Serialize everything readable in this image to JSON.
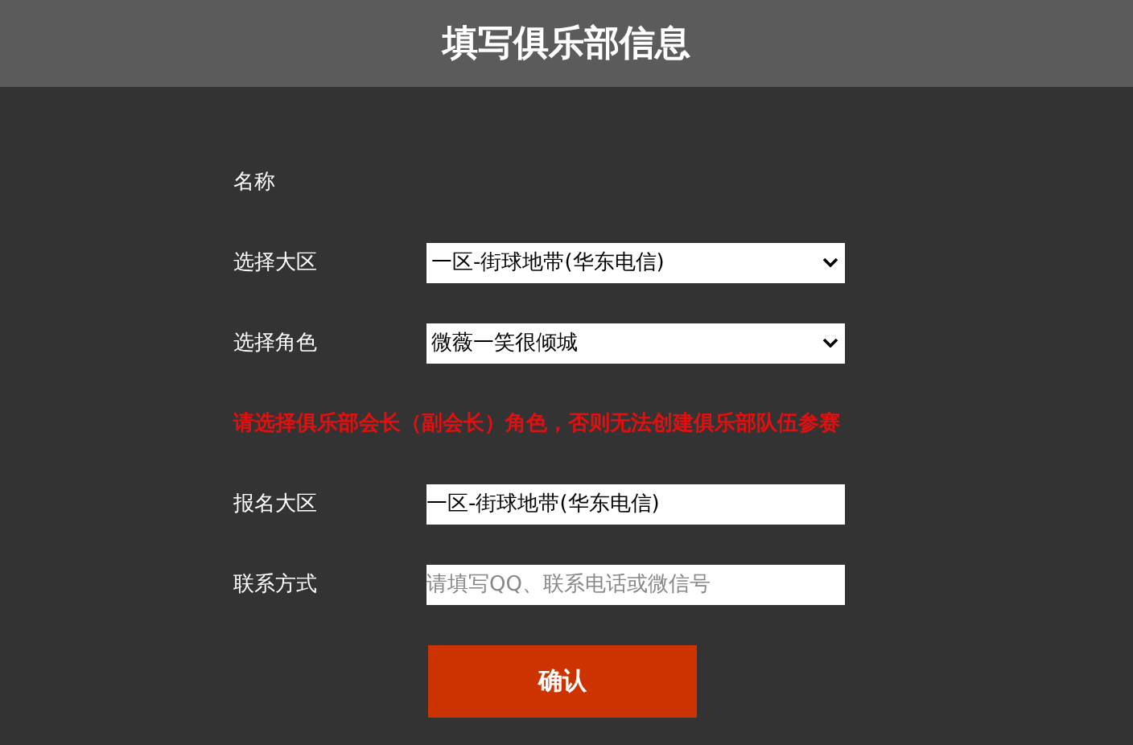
{
  "header": {
    "title": "填写俱乐部信息"
  },
  "rows": [
    {
      "kind": "label",
      "label": "名称"
    },
    {
      "kind": "select",
      "label": "选择大区",
      "value": "一区-街球地带(华东电信)"
    },
    {
      "kind": "select",
      "label": "选择角色",
      "value": "微薇一笑很倾城"
    },
    {
      "kind": "notice",
      "text": "请选择俱乐部会长（副会长）角色，否则无法创建俱乐部队伍参赛"
    },
    {
      "kind": "input",
      "label": "报名大区",
      "value": "一区-街球地带(华东电信)"
    },
    {
      "kind": "input",
      "label": "联系方式",
      "placeholder": "请填写QQ、联系电话或微信号"
    }
  ],
  "confirm_button": "确认"
}
